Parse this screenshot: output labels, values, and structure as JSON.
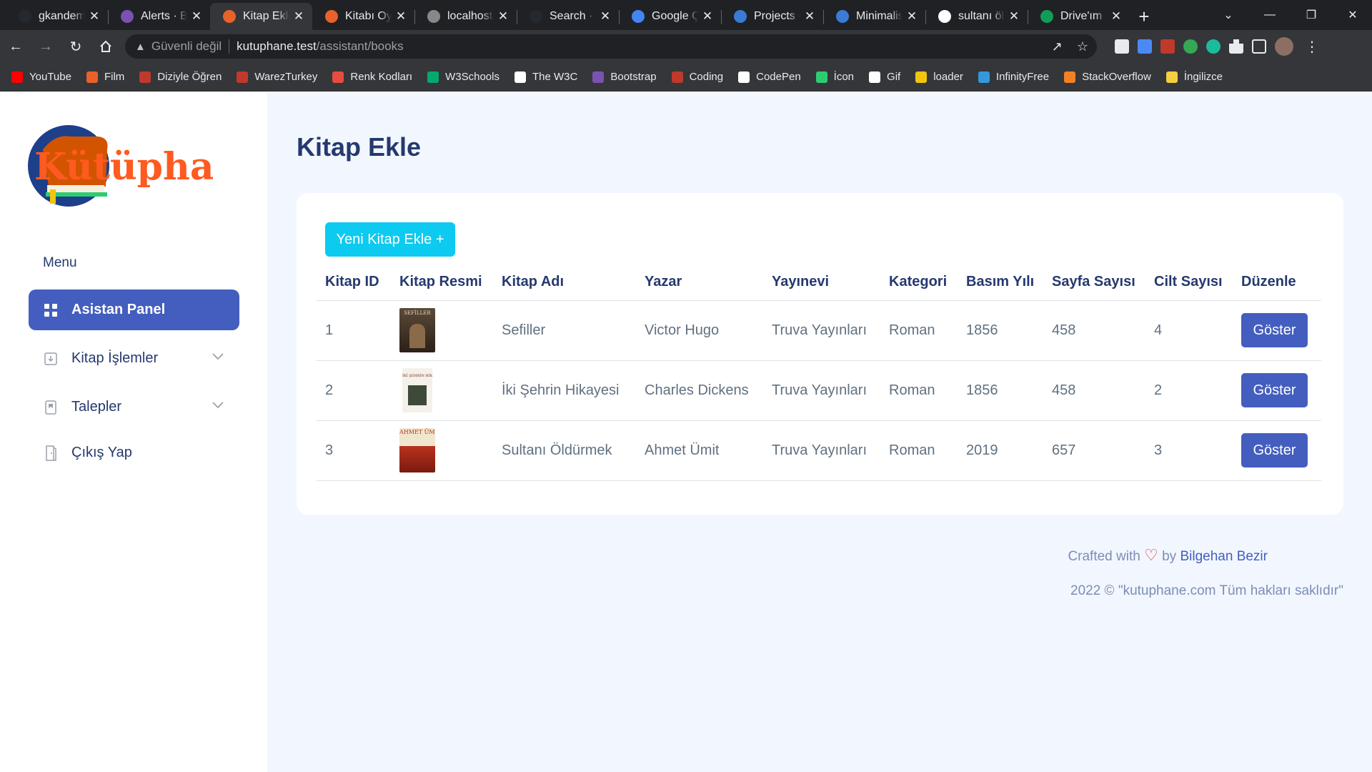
{
  "browser": {
    "tabs": [
      {
        "title": "gkandemir",
        "color": "#24292f"
      },
      {
        "title": "Alerts · Bootstrap",
        "color": "#7952b3"
      },
      {
        "title": "Kitap Ekle",
        "color": "#e8622a",
        "active": true
      },
      {
        "title": "Kitabı Oyla",
        "color": "#e8622a"
      },
      {
        "title": "localhost",
        "color": "#888888"
      },
      {
        "title": "Search · f",
        "color": "#24292f"
      },
      {
        "title": "Google Çeviri",
        "color": "#4285f4"
      },
      {
        "title": "Projects - ",
        "color": "#3a7bd5"
      },
      {
        "title": "Minimalist",
        "color": "#3a7bd5"
      },
      {
        "title": "sultanı öl",
        "color": "#ffffff"
      },
      {
        "title": "Drive'ım",
        "color": "#0f9d58"
      }
    ],
    "new_tab": "+",
    "window_controls": {
      "dropdown": "⌄",
      "minimize": "—",
      "maximize": "❐",
      "close": "✕"
    },
    "address": {
      "security_label": "Güvenli değil",
      "host": "kutuphane.test",
      "path": "/assistant/books"
    },
    "bookmarks": [
      {
        "label": "YouTube",
        "color": "#ff0000"
      },
      {
        "label": "Film",
        "color": "#e8622a"
      },
      {
        "label": "Diziyle Öğren",
        "color": "#c0392b"
      },
      {
        "label": "WarezTurkey",
        "color": "#c0392b"
      },
      {
        "label": "Renk Kodları",
        "color": "#e74c3c"
      },
      {
        "label": "W3Schools",
        "color": "#04aa6d"
      },
      {
        "label": "The W3C",
        "color": "#ffffff"
      },
      {
        "label": "Bootstrap",
        "color": "#7952b3"
      },
      {
        "label": "Coding",
        "color": "#c0392b"
      },
      {
        "label": "CodePen",
        "color": "#ffffff"
      },
      {
        "label": "İcon",
        "color": "#2ecc71"
      },
      {
        "label": "Gif",
        "color": "#ffffff"
      },
      {
        "label": "loader",
        "color": "#f1c40f"
      },
      {
        "label": "InfinityFree",
        "color": "#3498db"
      },
      {
        "label": "StackOverflow",
        "color": "#f48024"
      },
      {
        "label": "İngilizce",
        "color": "#f4d03f"
      }
    ]
  },
  "sidebar": {
    "logo_text": "Kütüphane",
    "menu_title": "Menu",
    "items": [
      {
        "label": "Asistan Panel",
        "icon": "grid-icon",
        "active": true
      },
      {
        "label": "Kitap İşlemler",
        "icon": "download-box-icon",
        "has_submenu": true
      },
      {
        "label": "Talepler",
        "icon": "bookmark-icon",
        "has_submenu": true
      },
      {
        "label": "Çıkış Yap",
        "icon": "door-icon"
      }
    ]
  },
  "main": {
    "title": "Kitap Ekle",
    "add_button": "Yeni Kitap Ekle +",
    "table": {
      "headers": [
        "Kitap ID",
        "Kitap Resmi",
        "Kitap Adı",
        "Yazar",
        "Yayınevi",
        "Kategori",
        "Basım Yılı",
        "Sayfa Sayısı",
        "Cilt Sayısı",
        "Düzenle"
      ],
      "rows": [
        {
          "id": "1",
          "cover": "SEFİLLER",
          "title": "Sefiller",
          "author": "Victor Hugo",
          "publisher": "Truva Yayınları",
          "category": "Roman",
          "year": "1856",
          "pages": "458",
          "volumes": "4",
          "action": "Göster"
        },
        {
          "id": "2",
          "cover": "İKİ ŞEHRİN HİKAYESİ",
          "title": "İki Şehrin Hikayesi",
          "author": "Charles Dickens",
          "publisher": "Truva Yayınları",
          "category": "Roman",
          "year": "1856",
          "pages": "458",
          "volumes": "2",
          "action": "Göster"
        },
        {
          "id": "3",
          "cover": "AHMET ÜMİT",
          "title": "Sultanı Öldürmek",
          "author": "Ahmet Ümit",
          "publisher": "Truva Yayınları",
          "category": "Roman",
          "year": "2019",
          "pages": "657",
          "volumes": "3",
          "action": "Göster"
        }
      ]
    }
  },
  "footer": {
    "crafted_prefix": "Crafted with",
    "heart": "♡",
    "crafted_by": "by",
    "author": "Bilgehan Bezir",
    "copyright": "2022 © \"kutuphane.com Tüm hakları saklıdır\""
  }
}
